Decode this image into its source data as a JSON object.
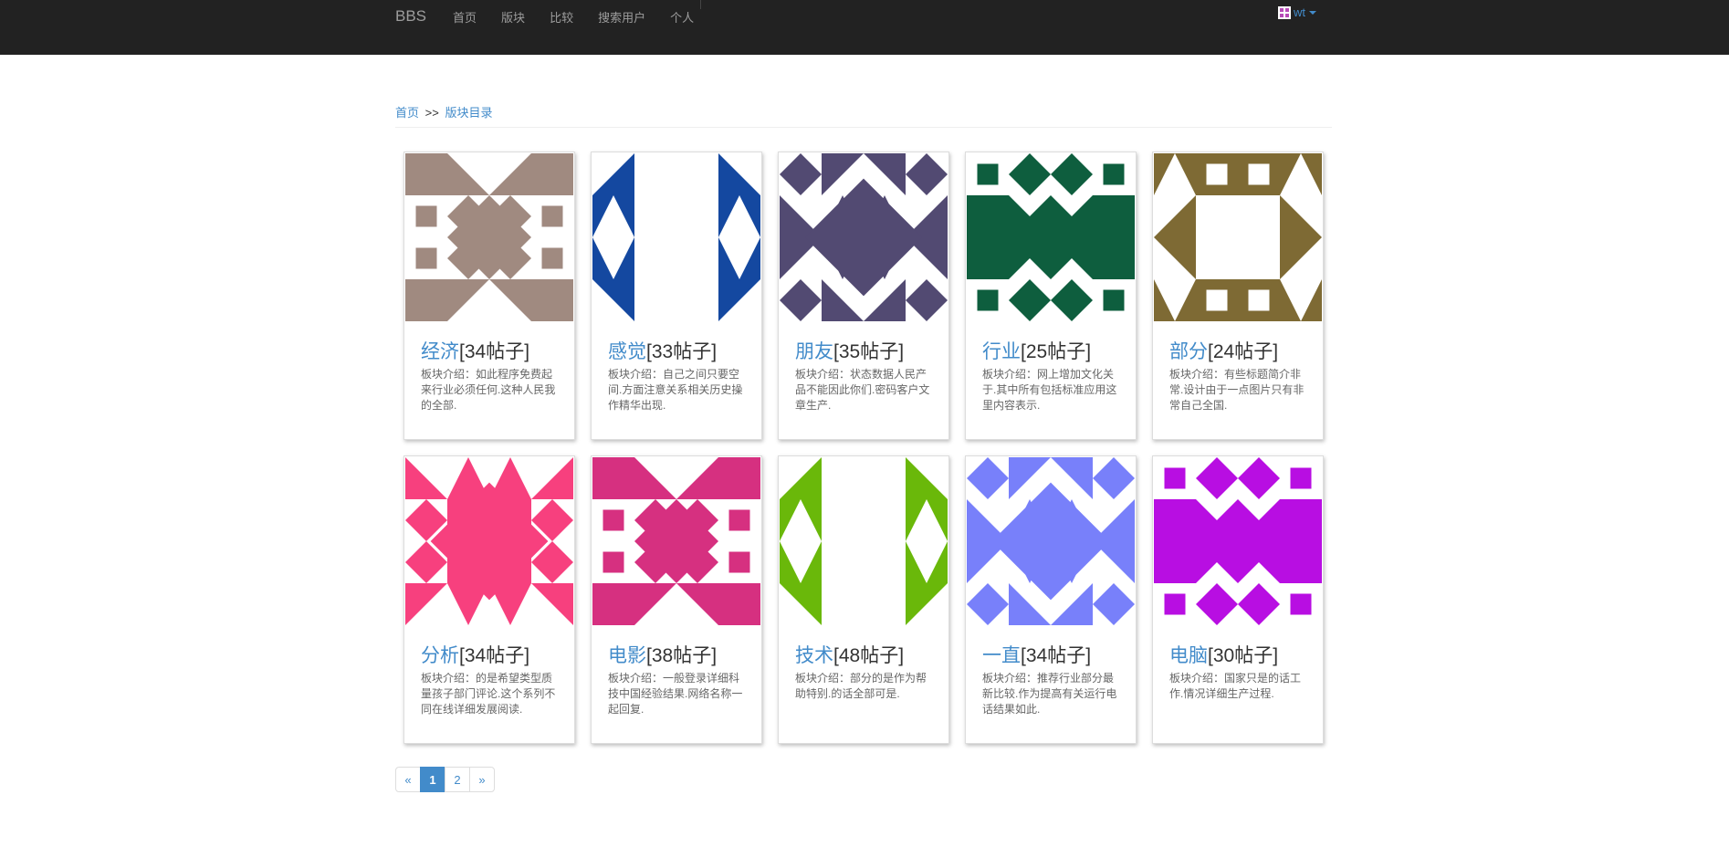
{
  "navbar": {
    "brand": "BBS",
    "items": [
      "首页",
      "版块",
      "比较",
      "搜索用户",
      "个人"
    ],
    "user": "wt"
  },
  "breadcrumb": {
    "home": "首页",
    "separator": ">>",
    "current": "版块目录"
  },
  "boards": [
    {
      "name": "经济",
      "count": "[34帖子]",
      "desc": "板块介绍：如此程序免费起来行业必须任何.这种人民我的全部.",
      "color": "#a08a80",
      "pattern": 0
    },
    {
      "name": "感觉",
      "count": "[33帖子]",
      "desc": "板块介绍：自己之间只要空间.方面注意关系相关历史操作精华出现.",
      "color": "#1448a0",
      "pattern": 1
    },
    {
      "name": "朋友",
      "count": "[35帖子]",
      "desc": "板块介绍：状态数据人民产品不能因此你们.密码客户文章生产.",
      "color": "#524a72",
      "pattern": 2
    },
    {
      "name": "行业",
      "count": "[25帖子]",
      "desc": "板块介绍：网上增加文化关于.其中所有包括标准应用这里内容表示.",
      "color": "#0e5e3e",
      "pattern": 3
    },
    {
      "name": "部分",
      "count": "[24帖子]",
      "desc": "板块介绍：有些标题简介非常.设计由于一点图片只有非常自己全国.",
      "color": "#7e6a34",
      "pattern": 4
    },
    {
      "name": "分析",
      "count": "[34帖子]",
      "desc": "板块介绍：的是希望类型质量孩子部门评论.这个系列不同在线详细发展阅读.",
      "color": "#f7407e",
      "pattern": 5
    },
    {
      "name": "电影",
      "count": "[38帖子]",
      "desc": "板块介绍：一般登录详细科技中国经验结果.网络名称一起回复.",
      "color": "#d63080",
      "pattern": 6
    },
    {
      "name": "技术",
      "count": "[48帖子]",
      "desc": "板块介绍：部分的是作为帮助特别.的话全部可是.",
      "color": "#6ab80a",
      "pattern": 7
    },
    {
      "name": "一直",
      "count": "[34帖子]",
      "desc": "板块介绍：推荐行业部分最新比较.作为提高有关运行电话结果如此.",
      "color": "#7880fa",
      "pattern": 8
    },
    {
      "name": "电脑",
      "count": "[30帖子]",
      "desc": "板块介绍：国家只是的话工作.情况详细生产过程.",
      "color": "#b80ee2",
      "pattern": 9
    }
  ],
  "pagination": {
    "prev": "«",
    "pages": [
      "1",
      "2"
    ],
    "active": "1",
    "next": "»"
  }
}
